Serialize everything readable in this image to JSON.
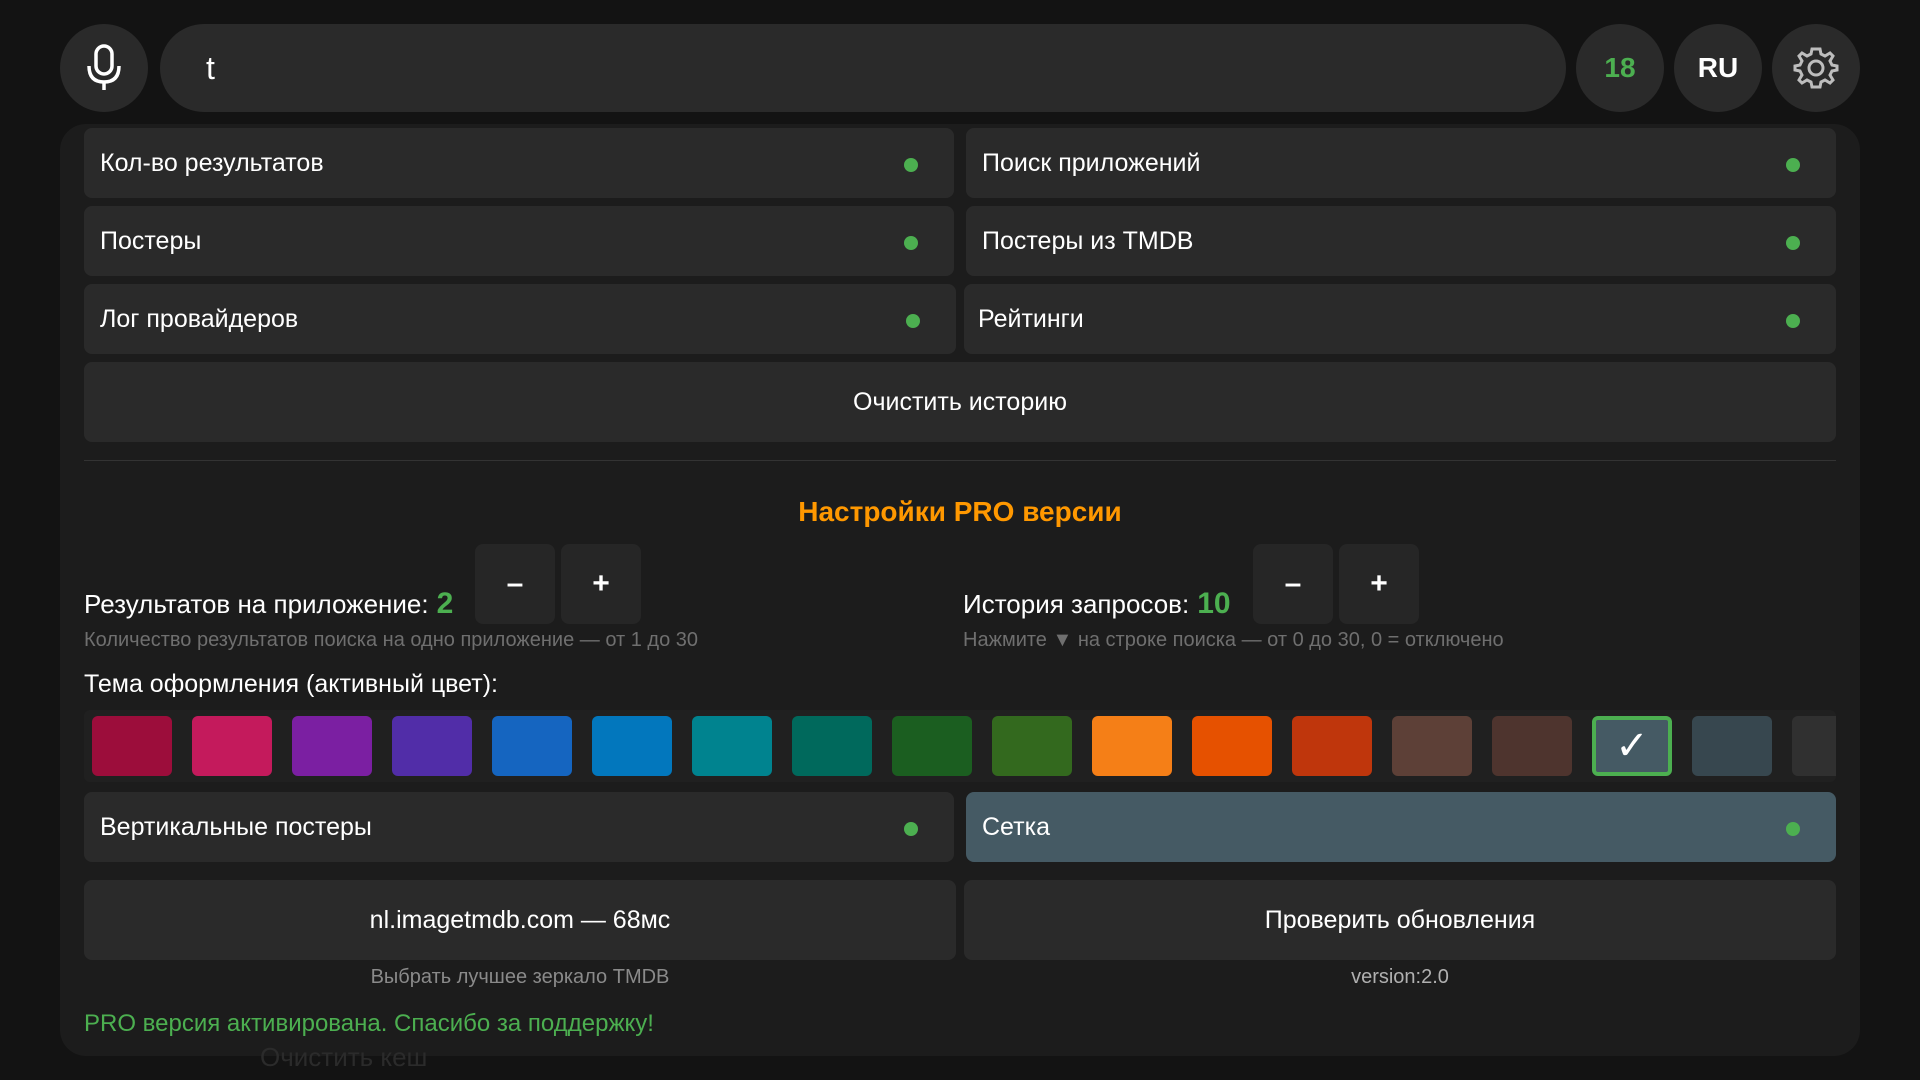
{
  "search": {
    "value": "t"
  },
  "header": {
    "count": "18",
    "language": "RU"
  },
  "toggles_top": [
    {
      "label": "Кол-во результатов"
    },
    {
      "label": "Поиск приложений"
    },
    {
      "label": "Постеры"
    },
    {
      "label": "Постеры из TMDB"
    },
    {
      "label": "Лог провайдеров"
    },
    {
      "label": "Рейтинги"
    }
  ],
  "clear_history_label": "Очистить историю",
  "pro": {
    "title": "Настройки PRO версии",
    "results_per_app": {
      "label": "Результатов на приложение:",
      "value": "2",
      "hint": "Количество результатов поиска на одно приложение — от 1 до 30"
    },
    "history": {
      "label": "История запросов:",
      "value": "10",
      "hint": "Нажмите ▼ на строке поиска — от 0 до 30, 0 = отключено"
    },
    "minus": "–",
    "plus": "+",
    "theme_label": "Тема оформления (активный цвет):",
    "theme_colors": [
      "#9c0d3b",
      "#c41a5c",
      "#7b1fa2",
      "#512da8",
      "#1565c0",
      "#0277bd",
      "#00838f",
      "#00695c",
      "#1b5e20",
      "#33691e",
      "#f57f17",
      "#e65100",
      "#bf360c",
      "#5d4037",
      "#4e342e",
      "#455a64",
      "#37474f",
      "#303030"
    ],
    "selected_color_index": 15,
    "selected_mark": "✓",
    "vertical_posters": "Вертикальные постеры",
    "grid": "Сетка",
    "mirror_button": "nl.imagetmdb.com — 68мс",
    "mirror_hint": "Выбрать лучшее зеркало TMDB",
    "update_button": "Проверить обновления",
    "version": "version:2.0",
    "activated_msg": "PRO версия активирована. Спасибо за поддержку!",
    "clear_cache": "Очистить кеш"
  },
  "colors": {
    "accent": "#4caf50",
    "pro_title": "#ff9800"
  },
  "icons": {
    "mic": "microphone-icon",
    "settings": "gear-icon"
  }
}
